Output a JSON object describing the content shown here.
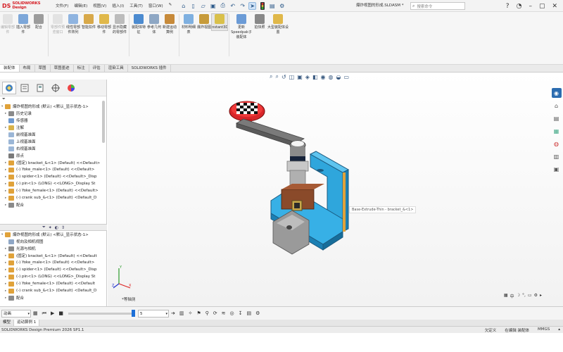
{
  "app": {
    "logo_mark": "DS",
    "logo_text": "SOLIDWORKS Design",
    "document_name": "爆炸视图的形成.SLDASM *",
    "search_placeholder": "搜索命令"
  },
  "menus": [
    "文件(F)",
    "编辑(E)",
    "视图(V)",
    "插入(I)",
    "工具(T)",
    "窗口(W)"
  ],
  "ribbon": {
    "buttons": [
      {
        "label": "编辑零部件",
        "disabled": true,
        "color": "#c9c9c9"
      },
      {
        "label": "插入零部件",
        "disabled": false,
        "color": "#7da7d9"
      },
      {
        "label": "配合",
        "disabled": false,
        "color": "#9c9c9c"
      },
      {
        "label": "零部件预览窗口",
        "disabled": true,
        "color": "#c9c9c9"
      },
      {
        "label": "线性零部件阵列",
        "disabled": false,
        "color": "#8fb4e0"
      },
      {
        "label": "智能扣件",
        "disabled": false,
        "color": "#d8a94a"
      },
      {
        "label": "移动零部件",
        "disabled": false,
        "color": "#e0b84a"
      },
      {
        "label": "显示隐藏的零部件",
        "disabled": false,
        "color": "#bcbcbc"
      },
      {
        "label": "装配体特征",
        "disabled": false,
        "color": "#4c8bd0"
      },
      {
        "label": "参考几何体",
        "disabled": false,
        "color": "#8ea7c4"
      },
      {
        "label": "新建运动算例",
        "disabled": false,
        "color": "#c78a3a"
      },
      {
        "label": "材料明细表",
        "disabled": false,
        "color": "#7fb0e0"
      },
      {
        "label": "爆炸视图",
        "disabled": false,
        "color": "#c79b3a"
      },
      {
        "label": "Instant3D",
        "disabled": false,
        "color": "#d9c04a"
      },
      {
        "label": "更新Speedpak子装配体",
        "disabled": false,
        "color": "#6b9bd6"
      },
      {
        "label": "拍快照",
        "disabled": false,
        "color": "#888888"
      },
      {
        "label": "大型装配体设置",
        "disabled": false,
        "color": "#e0b84a"
      }
    ]
  },
  "command_tabs": [
    "装配体",
    "布局",
    "草图",
    "草图墨迹",
    "标注",
    "评估",
    "渲染工具",
    "SOLIDWORKS 插件"
  ],
  "feature_tree_top": {
    "root": "爆炸视图的形成 (默认) <默认_显示状态-1>",
    "items": [
      {
        "label": "历史记录",
        "arrow": "▸",
        "color": "#8a8a8a"
      },
      {
        "label": "传感器",
        "arrow": "",
        "color": "#6f9ad0"
      },
      {
        "label": "注解",
        "arrow": "▸",
        "color": "#d8b24a"
      },
      {
        "label": "前视基准面",
        "arrow": "",
        "color": "#9bb6d6"
      },
      {
        "label": "上视基准面",
        "arrow": "",
        "color": "#9bb6d6"
      },
      {
        "label": "右视基准面",
        "arrow": "",
        "color": "#9bb6d6"
      },
      {
        "label": "原点",
        "arrow": "",
        "color": "#7a7a7a"
      },
      {
        "label": "(固定) bracket_&<1> (Default) <<Default>",
        "arrow": "▸",
        "color": "#e0a23a"
      },
      {
        "label": "(-) Yoke_male<1> (Default) <<Default>",
        "arrow": "▸",
        "color": "#e0a23a"
      },
      {
        "label": "(-) spider<1> (Default) <<Default>_Disp",
        "arrow": "▸",
        "color": "#e0a23a"
      },
      {
        "label": "(-) pin<1> (LONG) <<LONG>_Display St",
        "arrow": "▸",
        "color": "#e0a23a"
      },
      {
        "label": "(-) Yoke_female<1> (Default) <<Default>",
        "arrow": "▸",
        "color": "#e0a23a"
      },
      {
        "label": "(-) crank sub_&<1> (Default) <Default_D",
        "arrow": "▸",
        "color": "#e0a23a"
      },
      {
        "label": "配合",
        "arrow": "▸",
        "color": "#8a8a8a"
      }
    ]
  },
  "feature_tree_bottom": {
    "root": "爆炸视图的形成 (默认) <默认_显示状态-1>",
    "items": [
      {
        "label": "视向及相机视图",
        "arrow": "",
        "color": "#8fa7c6"
      },
      {
        "label": "光源与相机",
        "arrow": "▸",
        "color": "#8a8a8a"
      },
      {
        "label": "(固定) bracket_&<1> (Default) <<Default",
        "arrow": "▸",
        "color": "#e0a23a"
      },
      {
        "label": "(-) Yoke_male<1> (Default) <<Default>",
        "arrow": "▸",
        "color": "#e0a23a"
      },
      {
        "label": "(-) spider<1> (Default) <<Default>_Disp",
        "arrow": "▸",
        "color": "#e0a23a"
      },
      {
        "label": "(-) pin<1> (LONG) <<LONG>_Display St",
        "arrow": "▸",
        "color": "#e0a23a"
      },
      {
        "label": "(-) Yoke_female<1> (Default) <<Default",
        "arrow": "▸",
        "color": "#e0a23a"
      },
      {
        "label": "(-) crank sub_&<1> (Default) <Default_D",
        "arrow": "▸",
        "color": "#e0a23a"
      },
      {
        "label": "配合",
        "arrow": "▸",
        "color": "#8a8a8a"
      }
    ]
  },
  "viewport": {
    "tooltip": "Base-Extrude-Thin - bracket_&<1>",
    "view_label": "*等轴测"
  },
  "motion": {
    "study_type": "动画",
    "time_value": "5"
  },
  "bottom_tabs": [
    "模型",
    "运动算例 1"
  ],
  "status": {
    "left": "SOLIDWORKS Design Premium 2026 SP1.1",
    "mode": "欠定义",
    "editing": "在编辑 装配体",
    "units": "MMGS"
  },
  "colors": {
    "accent_blue": "#1c6fd8",
    "bracket_blue": "#29a8e0",
    "crank_red": "#e02a2a"
  }
}
